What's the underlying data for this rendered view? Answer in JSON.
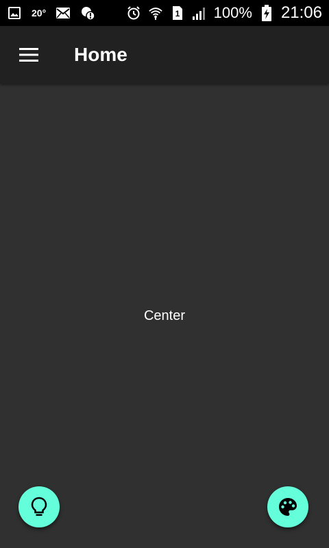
{
  "status_bar": {
    "icons_left": [
      "image-icon",
      "temperature-text",
      "mail-icon",
      "alert-cloud-icon"
    ],
    "temperature": "20°",
    "icons_right": [
      "alarm-icon",
      "wifi-icon",
      "sim-1-icon",
      "signal-icon",
      "battery-charging-icon"
    ],
    "sim_label": "1",
    "battery_percent": "100%",
    "time": "21:06"
  },
  "app_bar": {
    "title": "Home",
    "menu_icon": "hamburger-menu-icon",
    "background": "#212121"
  },
  "content": {
    "center_text": "Center",
    "background": "#303030"
  },
  "fabs": {
    "left_icon": "lightbulb-icon",
    "right_icon": "palette-icon",
    "accent": "#64ffda"
  }
}
